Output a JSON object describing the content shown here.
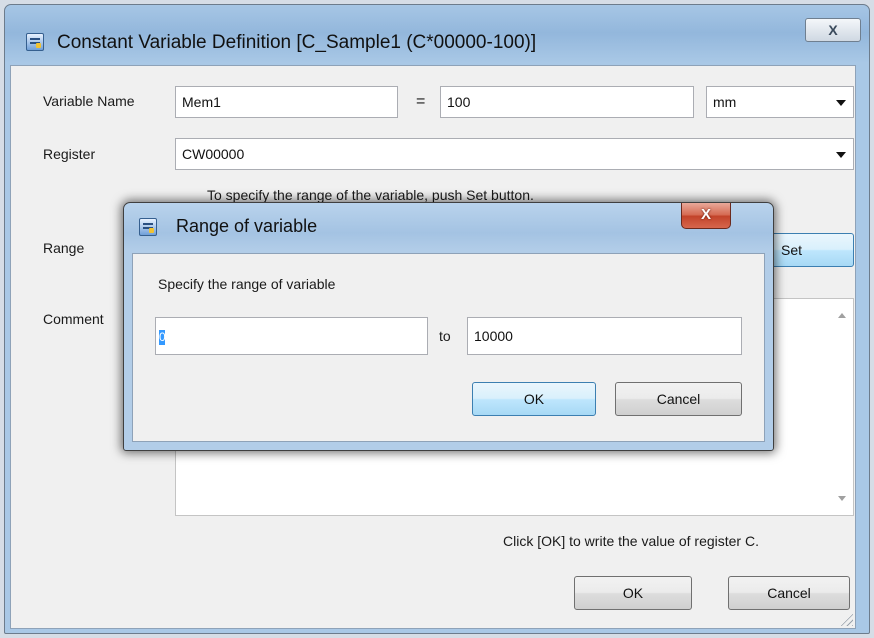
{
  "main_dialog": {
    "title": "Constant Variable Definition [C_Sample1 (C*00000-100)]",
    "close_label": "X",
    "variable_name_label": "Variable Name",
    "variable_name_value": "Mem1",
    "equals": "=",
    "value": "100",
    "unit": "mm",
    "register_label": "Register",
    "register_value": "CW00000",
    "range_hint": "To specify the range of the variable, push Set button.",
    "range_label": "Range",
    "set_button": "Set",
    "comment_label": "Comment",
    "comment_value": "",
    "footer_note": "Click [OK] to write the value of register C.",
    "ok_button": "OK",
    "cancel_button": "Cancel"
  },
  "range_dialog": {
    "title": "Range of variable",
    "close_label": "X",
    "instruction": "Specify the range of variable",
    "min_value": "0",
    "to_label": "to",
    "max_value": "10000",
    "ok_button": "OK",
    "cancel_button": "Cancel"
  },
  "icons": {
    "main": "app-window-icon",
    "range": "app-window-icon"
  },
  "colors": {
    "title_bar": "#a6c6e5",
    "close_red": "#c2432a",
    "focus_blue": "#3c7fb1"
  }
}
